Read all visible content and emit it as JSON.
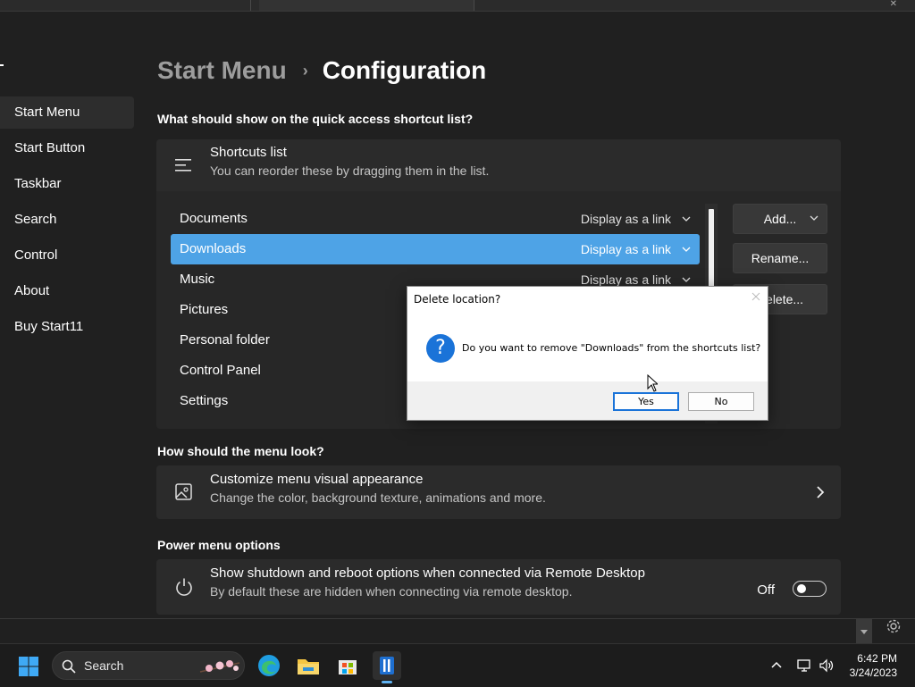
{
  "breadcrumb": {
    "parent": "Start Menu",
    "separator": "›",
    "current": "Configuration"
  },
  "sidebar": {
    "items": [
      {
        "label": "Start Menu",
        "active": true
      },
      {
        "label": "Start Button"
      },
      {
        "label": "Taskbar"
      },
      {
        "label": "Search"
      },
      {
        "label": "Control"
      },
      {
        "label": "About"
      },
      {
        "label": "Buy Start11"
      }
    ]
  },
  "quick_access": {
    "heading": "What should show on the quick access shortcut list?",
    "card_title": "Shortcuts list",
    "card_subtitle": "You can reorder these by dragging them in the list.",
    "items": [
      {
        "label": "Documents",
        "display": "Display as a link"
      },
      {
        "label": "Downloads",
        "display": "Display as a link",
        "selected": true
      },
      {
        "label": "Music",
        "display": "Display as a link"
      },
      {
        "label": "Pictures",
        "display": ""
      },
      {
        "label": "Personal folder",
        "display": ""
      },
      {
        "label": "Control Panel",
        "display": ""
      },
      {
        "label": "Settings",
        "display": ""
      }
    ],
    "buttons": {
      "add": "Add...",
      "rename": "Rename...",
      "delete": "Delete..."
    }
  },
  "look": {
    "heading": "How should the menu look?",
    "title": "Customize menu visual appearance",
    "subtitle": "Change the color, background texture, animations and more."
  },
  "power": {
    "heading": "Power menu options",
    "title": "Show shutdown and reboot options when connected via Remote Desktop",
    "subtitle": "By default these are hidden when connecting via remote desktop.",
    "toggle_label": "Off",
    "toggle_on": false
  },
  "dialog": {
    "title": "Delete location?",
    "icon": "question-icon",
    "icon_glyph": "?",
    "message": "Do you want to remove \"Downloads\" from the shortcuts list?",
    "yes": "Yes",
    "no": "No"
  },
  "taskbar": {
    "search_placeholder": "Search",
    "time": "6:42 PM",
    "date": "3/24/2023"
  },
  "colors": {
    "accent": "#4ea3e6",
    "dialog_accent": "#1a73d8",
    "background": "#202020",
    "card": "#2b2b2b"
  }
}
